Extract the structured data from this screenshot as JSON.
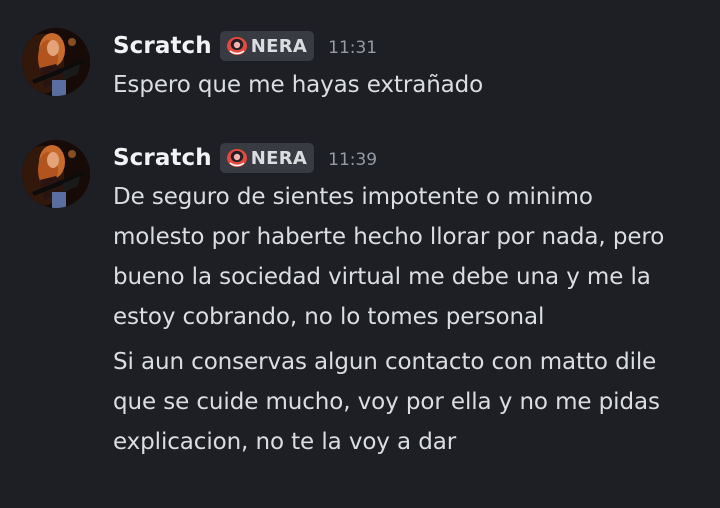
{
  "colors": {
    "background": "#1e1f24",
    "username": "#f2f3f5",
    "message_text": "#dbdee1",
    "timestamp": "#949ba4",
    "tag_background": "#393b43",
    "tag_icon": "#e8483f"
  },
  "messages": [
    {
      "author": "Scratch",
      "tag": "NERA",
      "tag_icon": "clan-badge-icon",
      "time": "11:31",
      "avatar": "avatar-guitarist",
      "paragraphs": [
        [
          "Espero que me hayas extrañado"
        ]
      ]
    },
    {
      "author": "Scratch",
      "tag": "NERA",
      "tag_icon": "clan-badge-icon",
      "time": "11:39",
      "avatar": "avatar-guitarist",
      "paragraphs": [
        [
          "De seguro de sientes impotente o minimo",
          "molesto por haberte hecho llorar por nada, pero",
          "bueno la sociedad virtual me debe una y me la",
          "estoy cobrando, no lo tomes personal"
        ],
        [
          "Si aun conservas algun contacto con matto dile",
          "que se cuide mucho, voy por ella y no me pidas",
          "explicacion, no te la voy a dar"
        ]
      ]
    }
  ]
}
